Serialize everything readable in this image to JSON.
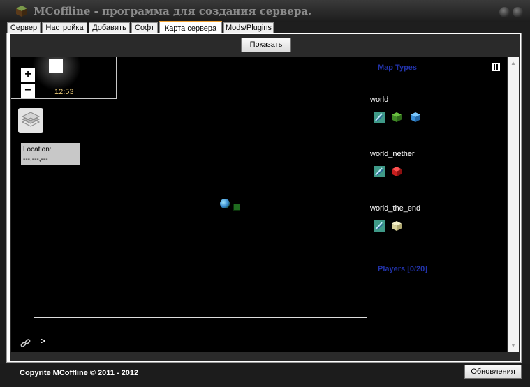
{
  "window": {
    "title": "MCoffline - программа для создания сервера."
  },
  "tabs": [
    {
      "label": "Сервер"
    },
    {
      "label": "Настройка"
    },
    {
      "label": "Добавить"
    },
    {
      "label": "Софт"
    },
    {
      "label": "Карта сервера",
      "active": true
    },
    {
      "label": "Mods/Plugins"
    }
  ],
  "toolbar": {
    "show_button": "Показать"
  },
  "map": {
    "time": "12:53",
    "zoom_in": "+",
    "zoom_out": "−",
    "location_label": "Location:",
    "location_value": "---,---,---",
    "console_prompt": ">"
  },
  "sidebar": {
    "map_types_title": "Map Types",
    "worlds": [
      {
        "name": "world",
        "icons": [
          "flat-map-icon",
          "surface-cube-icon",
          "water-cube-icon"
        ]
      },
      {
        "name": "world_nether",
        "icons": [
          "flat-map-icon",
          "nether-cube-icon"
        ]
      },
      {
        "name": "world_the_end",
        "icons": [
          "flat-map-icon",
          "end-cube-icon"
        ]
      }
    ],
    "players_title": "Players [0/20]"
  },
  "footer": {
    "copyright": "Copyrite MCoffline © 2011 - 2012",
    "update_button": "Обновления"
  },
  "colors": {
    "map_background": "#000000",
    "sidebar_title": "#2233aa",
    "clock_text": "#e8c878",
    "active_tab_accent": "#f0a030"
  }
}
